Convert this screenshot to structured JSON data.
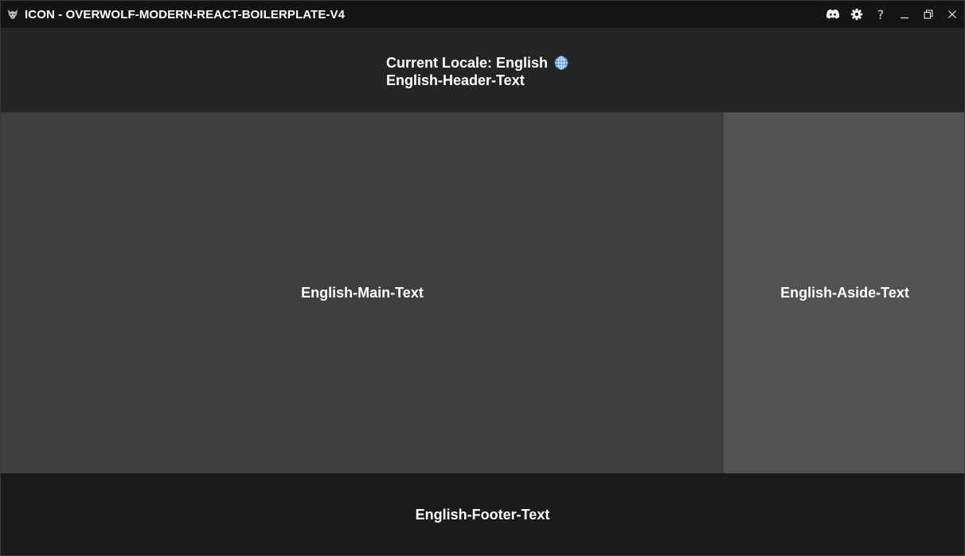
{
  "titlebar": {
    "title": "ICON - OVERWOLF-MODERN-REACT-BOILERPLATE-V4",
    "app_icon": "wolf-icon",
    "controls": [
      {
        "name": "discord-icon"
      },
      {
        "name": "gear-icon"
      },
      {
        "name": "help-icon",
        "glyph": "?"
      },
      {
        "name": "minimize-icon"
      },
      {
        "name": "restore-icon"
      },
      {
        "name": "close-icon"
      }
    ]
  },
  "header": {
    "locale_label": "Current Locale: English",
    "locale_icon": "globe-icon",
    "header_text": "English-Header-Text"
  },
  "main": {
    "text": "English-Main-Text"
  },
  "aside": {
    "text": "English-Aside-Text"
  },
  "footer": {
    "text": "English-Footer-Text"
  },
  "colors": {
    "titlebar_bg": "#151515",
    "header_bg": "#252525",
    "main_bg": "#3f3f3f",
    "aside_bg": "#525252",
    "footer_bg": "#1b1b1b",
    "globe_accent": "#6aa9e9"
  }
}
